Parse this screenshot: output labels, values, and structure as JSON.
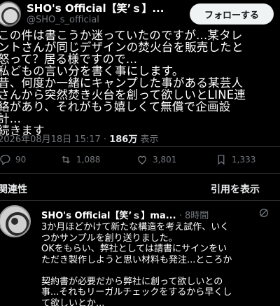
{
  "header": {
    "display_name": "SHO's Official【笑’ｓ】...",
    "handle": "@SHO_s_official",
    "follow_label": "フォローする"
  },
  "post": {
    "text": "この件は書こうか迷っていたのですが...某タレ\nントさんが同じデザインの焚火台を販売したと\n怒って？居る様ですので...\n私どもの言い分を書く事にします。\n昔、何度か一緒にキャンプした事がある某芸人\nさんから突然焚き火台を創って欲しいとLINE連\n絡があり、それがもう嬉しくて無償で企画設\n計...\n続きます",
    "timestamp": "2026年08月18日 15:17",
    "separator": "·",
    "views": "186万",
    "views_label": "表示"
  },
  "actions": {
    "replies": "90",
    "reposts": "1,088",
    "likes": "3,801",
    "bookmarks": "1,333"
  },
  "tabs": {
    "related": "関連性",
    "quotes": "引用を表示"
  },
  "reply": {
    "name": "SHO's Official【笑’ｓ】ma...",
    "time": "· 8時間",
    "text": "3か月ほどかけて新たな構造を考え試作、いく\nつかサンプルを創り送りました。\nOKをもらい、弊社としては請書にサインをい\nただき製作しようと思い材料も発注...ところか\n\n契約書が必要だから弊社に創って欲しいとの\n事...それもリーガルチェックをするから早くし\nて欲しいとか..."
  }
}
